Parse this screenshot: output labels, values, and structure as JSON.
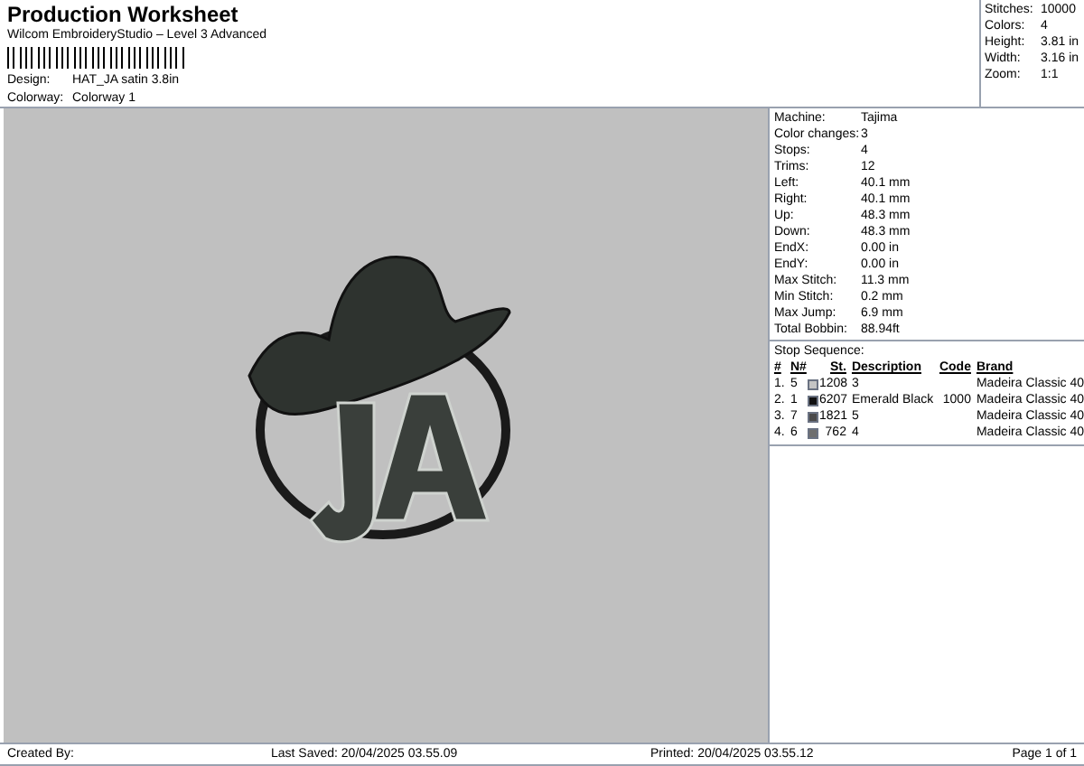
{
  "header": {
    "title": "Production Worksheet",
    "subtitle": "Wilcom EmbroideryStudio – Level 3 Advanced",
    "fields": [
      {
        "label": "Design:",
        "value": "HAT_JA satin 3.8in"
      },
      {
        "label": "Colorway:",
        "value": "Colorway 1"
      }
    ]
  },
  "summary": [
    {
      "label": "Stitches:",
      "value": "10000"
    },
    {
      "label": "Colors:",
      "value": "4"
    },
    {
      "label": "Height:",
      "value": "3.81 in"
    },
    {
      "label": "Width:",
      "value": "3.16 in"
    },
    {
      "label": "Zoom:",
      "value": "1:1"
    }
  ],
  "details": [
    {
      "label": "Machine:",
      "value": "Tajima"
    },
    {
      "label": "Color changes:",
      "value": "3"
    },
    {
      "label": "Stops:",
      "value": "4"
    },
    {
      "label": "Trims:",
      "value": "12"
    },
    {
      "label": "Left:",
      "value": "40.1 mm"
    },
    {
      "label": "Right:",
      "value": "40.1 mm"
    },
    {
      "label": "Up:",
      "value": "48.3 mm"
    },
    {
      "label": "Down:",
      "value": "48.3 mm"
    },
    {
      "label": "EndX:",
      "value": "0.00 in"
    },
    {
      "label": "EndY:",
      "value": "0.00 in"
    },
    {
      "label": "Max Stitch:",
      "value": "11.3 mm"
    },
    {
      "label": "Min Stitch:",
      "value": "0.2 mm"
    },
    {
      "label": "Max Jump:",
      "value": "6.9 mm"
    },
    {
      "label": "Total Bobbin:",
      "value": "88.94ft"
    }
  ],
  "stop_sequence": {
    "title": "Stop Sequence:",
    "columns": [
      "#",
      "N#",
      "St.",
      "Description",
      "Code",
      "Brand"
    ],
    "rows": [
      {
        "index": "1.",
        "needle": "5",
        "color": "#c4c4c4",
        "stitches": "1208",
        "description": "3",
        "code": "",
        "brand": "Madeira Classic 40"
      },
      {
        "index": "2.",
        "needle": "1",
        "color": "#111111",
        "stitches": "6207",
        "description": "Emerald Black",
        "code": "1000",
        "brand": "Madeira Classic 40"
      },
      {
        "index": "3.",
        "needle": "7",
        "color": "#4a4a4a",
        "stitches": "1821",
        "description": "5",
        "code": "",
        "brand": "Madeira Classic 40"
      },
      {
        "index": "4.",
        "needle": "6",
        "color": "#6e6e6e",
        "stitches": "762",
        "description": "4",
        "code": "",
        "brand": "Madeira Classic 40"
      }
    ]
  },
  "footer": {
    "created_by": "Created By:",
    "last_saved": "Last Saved: 20/04/2025 03.55.09",
    "printed": "Printed: 20/04/2025 03.55.12",
    "page": "Page 1 of 1"
  }
}
